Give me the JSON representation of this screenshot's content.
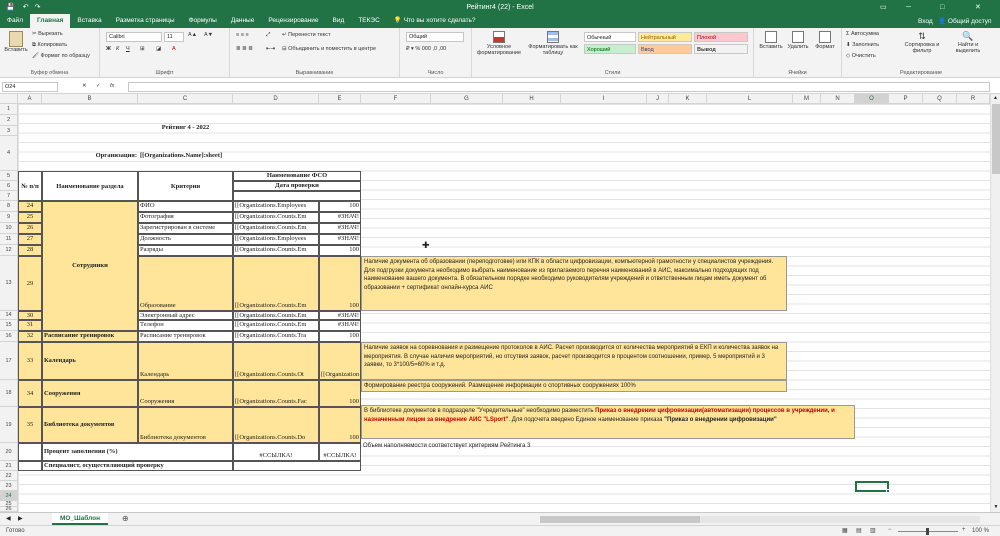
{
  "title_bar": {
    "title": "Рейтинг4 (22) - Excel",
    "user": "Вход",
    "share": "Общий доступ"
  },
  "tabs": [
    "Файл",
    "Главная",
    "Вставка",
    "Разметка страницы",
    "Формулы",
    "Данные",
    "Рецензирование",
    "Вид",
    "ТЕКЭС"
  ],
  "tell_me": "Что вы хотите сделать?",
  "ribbon": {
    "clipboard": {
      "paste": "Вставить",
      "cut": "Вырезать",
      "copy": "Копировать",
      "format_painter": "Формат по образцу",
      "label": "Буфер обмена"
    },
    "font": {
      "name": "Calibri",
      "size": "11",
      "label": "Шрифт"
    },
    "alignment": {
      "wrap": "Перенести текст",
      "merge": "Объединить и поместить в центре",
      "label": "Выравнивание"
    },
    "number": {
      "format": "Общий",
      "label": "Число"
    },
    "styles": {
      "conditional": "Условное форматирование",
      "as_table": "Форматировать как таблицу",
      "cells": [
        "Обычный",
        "Нейтральный",
        "Плохой",
        "Хороший",
        "Ввод",
        "Вывод"
      ],
      "label": "Стили"
    },
    "cells": {
      "insert": "Вставить",
      "delete": "Удалить",
      "format": "Формат",
      "label": "Ячейки"
    },
    "editing": {
      "autosum": "Автосумма",
      "fill": "Заполнить",
      "clear": "Очистить",
      "sort": "Сортировка и фильтр",
      "find": "Найти и выделить",
      "label": "Редактирование"
    }
  },
  "formula_bar": {
    "name_box": "O24",
    "fx": "fx",
    "content": ""
  },
  "columns": [
    "A",
    "B",
    "C",
    "D",
    "E",
    "F",
    "G",
    "H",
    "I",
    "J",
    "K",
    "L",
    "M",
    "N",
    "O",
    "P",
    "Q",
    "R"
  ],
  "rows": [
    "1",
    "2",
    "3",
    "4",
    "5",
    "6",
    "7",
    "8",
    "9",
    "10",
    "11",
    "12",
    "13",
    "14",
    "15",
    "16",
    "17",
    "18",
    "19",
    "20",
    "21",
    "22",
    "23",
    "24",
    "25",
    "26"
  ],
  "sheet": {
    "title": "Рейтинг 4 - 2022",
    "org_label": "Организация:",
    "org_value": "[[Organizations.Name]:sheet]",
    "hdr_num": "№ п/п",
    "hdr_section": "Наименование раздела",
    "hdr_criteria": "Критерии",
    "hdr_fso": "Наименование ФСО",
    "hdr_date": "Дата проверки",
    "employees": "Сотрудники",
    "items": [
      {
        "n": "24",
        "crit": "ФИО",
        "d": "[[Organizations.Employees",
        "e": "100"
      },
      {
        "n": "25",
        "crit": "Фотография",
        "d": "[[Organizations.Counts.Em",
        "e": "#ЗНАЧ!"
      },
      {
        "n": "26",
        "crit": "Зарегистрирован в системе",
        "d": "[[Organizations.Counts.Em",
        "e": "#ЗНАЧ!"
      },
      {
        "n": "27",
        "crit": "Должность",
        "d": "[[Organizations.Employees",
        "e": "#ЗНАЧ!"
      },
      {
        "n": "28",
        "crit": "Разряды",
        "d": "[[Organizations.Counts.Em",
        "e": "100"
      },
      {
        "n": "29",
        "crit": "Образование",
        "d": "[[Organizations.Counts.Em",
        "e": "100"
      },
      {
        "n": "30",
        "crit": "Электронный адрес",
        "d": "[[Organizations.Counts.Em",
        "e": "#ЗНАЧ!"
      },
      {
        "n": "31",
        "crit": "Телефон",
        "d": "[[Organizations.Counts.Em",
        "e": "#ЗНАЧ!"
      },
      {
        "n": "32",
        "sec": "Расписание тренировок",
        "crit": "Расписание тренировок",
        "d": "[[Organizations.Counts.Tra",
        "e": "100"
      },
      {
        "n": "33",
        "sec": "Календарь",
        "crit": "Календарь",
        "d": "[[Organizations.Counts.Ot",
        "e": "[[Organization"
      },
      {
        "n": "34",
        "sec": "Сооружения",
        "crit": "Сооружения",
        "d": "[[Organizations.Counts.Fac",
        "e": "100"
      },
      {
        "n": "35",
        "sec": "Библиотека документов",
        "crit": "Библиотека документов",
        "d": "[[Organizations.Counts.Do",
        "e": "100"
      }
    ],
    "percent_label": "Процент заполнения (%)",
    "percent_d": "#ССЫЛКА!",
    "percent_e": "#ССЫЛКА!",
    "specialist": "Специалист, осуществляющий проверку"
  },
  "notes": {
    "education": "Наличие документа об образовании (переподготовке) или КПК в области цифровизации, компьютерной грамотности у специалистов учреждения. Для подгрузки документа необходимо выбрать наименование из прилагаемого перечня наименований в АИС, максимально подходящих под наименование вашего документа. В обязательном порядке необходимо руководителям учреждений и ответственным лицам иметь документ об образовании + сертификат онлайн-курса АИС",
    "calendar": "Наличие заявок на соревнования и размещение протоколов в АИС. Расчет производится от количества мероприятий в ЕКП и количества заявок на мероприятия. В случае наличия мероприятий, но отсутвия заявок, расчет производится в процентом соотношении, пример, 5 мероприятий и 3 заявки, то 3*100/5=60% и т.д.",
    "facilities": "Формирование реестра сооружений. Размещение информации о спортивных сооружениях 100%",
    "library_1": "В библиотеке документов в подразделе \"Учредительные\" необходимо разместить ",
    "library_red": "Приказ о внедрении цифровизации(автоматизации) процессов в учреждении, и назначенным лицом за внедрение АИС \"LSport\"",
    "library_2": ". Для подсчета введено Единое наименование приказа ",
    "library_bold": "\"Приказ о внедрении цифровизации\"",
    "criteria": "Объем наполняемости соответствует критериям Рейтинга 3"
  },
  "sheet_tab": "МО_Шаблон",
  "status": "Готово",
  "zoom": "100 %"
}
